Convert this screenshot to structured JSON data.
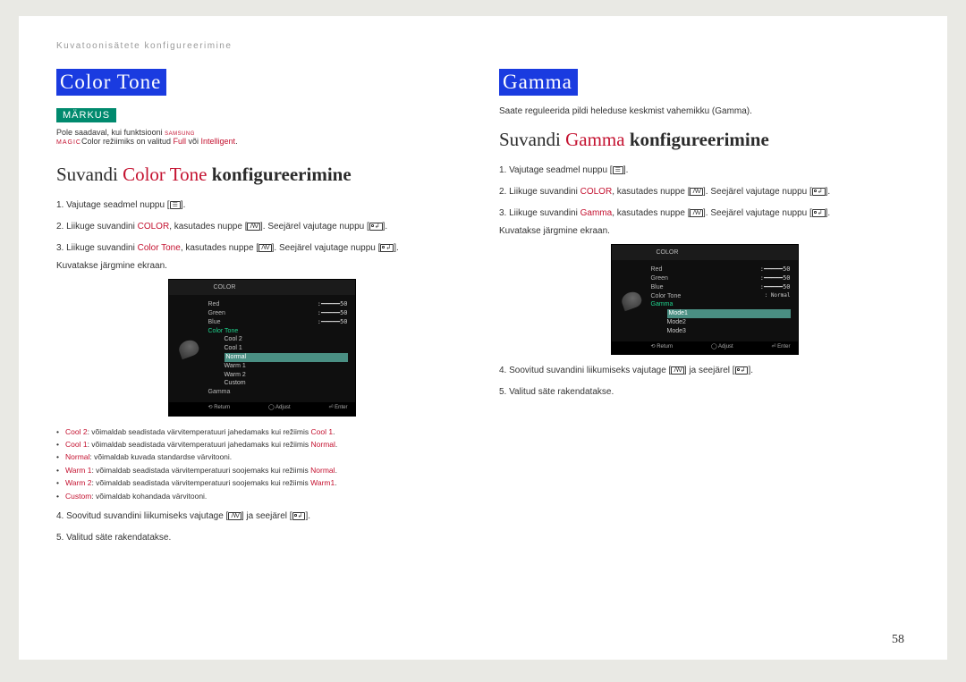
{
  "breadcrumb": "Kuvatoonisätete konfigureerimine",
  "left": {
    "title": "Color Tone",
    "note_label": "MÄRKUS",
    "note_before": "Pole saadaval, kui funktsiooni ",
    "samsung_top": "SAMSUNG",
    "samsung_bot": "MAGIC",
    "note_mid": "Color režiimiks on valitud ",
    "note_full": "Full",
    "note_or": " või ",
    "note_intel": "Intelligent",
    "note_end": ".",
    "subtitle_pre": "Suvandi ",
    "subtitle_accent": "Color Tone",
    "subtitle_post": " konfigureerimine",
    "step1": "Vajutage seadmel nuppu [",
    "step1_end": "].",
    "step2a": "Liikuge suvandini ",
    "step2_color": "COLOR",
    "step2b": ", kasutades nuppe [",
    "step2c": "]. Seejärel vajutage nuppu [",
    "step2d": "].",
    "step3a": "Liikuge suvandini ",
    "step3_ct": "Color Tone",
    "step3b": ", kasutades nuppe [",
    "step3c": "]. Seejärel vajutage nuppu [",
    "step3d": "].",
    "step3_sub": "Kuvatakse järgmine ekraan.",
    "bullets": {
      "b1_k": "Cool 2",
      "b1_t": ": võimaldab seadistada värvitemperatuuri jahedamaks kui režiimis ",
      "b1_r": "Cool 1",
      "b1_e": ".",
      "b2_k": "Cool 1",
      "b2_t": ": võimaldab seadistada värvitemperatuuri jahedamaks kui režiimis ",
      "b2_r": "Normal",
      "b2_e": ".",
      "b3_k": "Normal",
      "b3_t": ": võimaldab kuvada standardse värvitooni.",
      "b4_k": "Warm 1",
      "b4_t": ": võimaldab seadistada värvitemperatuuri soojemaks kui režiimis ",
      "b4_r": "Normal",
      "b4_e": ".",
      "b5_k": "Warm 2",
      "b5_t": ": võimaldab seadistada värvitemperatuuri soojemaks kui režiimis ",
      "b5_r": "Warm1",
      "b5_e": ".",
      "b6_k": "Custom",
      "b6_t": ": võimaldab kohandada värvitooni."
    },
    "step4a": "Soovitud suvandini liikumiseks vajutage [",
    "step4b": "] ja seejärel [",
    "step4c": "].",
    "step5": "Valitud säte rakendatakse.",
    "osd": {
      "hdr": "COLOR",
      "rows": [
        {
          "lab": "Red",
          "val": "50"
        },
        {
          "lab": "Green",
          "val": "50"
        },
        {
          "lab": "Blue",
          "val": "50"
        }
      ],
      "ct_label": "Color Tone",
      "ct_opts": [
        "Cool 2",
        "Cool 1",
        "Normal",
        "Warm 1",
        "Warm 2",
        "Custom"
      ],
      "gamma_label": "Gamma",
      "ftr_return": "Return",
      "ftr_adjust": "Adjust",
      "ftr_enter": "Enter"
    }
  },
  "right": {
    "title": "Gamma",
    "intro": "Saate reguleerida pildi heleduse keskmist vahemikku (Gamma).",
    "subtitle_pre": "Suvandi ",
    "subtitle_accent": "Gamma",
    "subtitle_post": " konfigureerimine",
    "step1": "Vajutage seadmel nuppu [",
    "step1_end": "].",
    "step2a": "Liikuge suvandini ",
    "step2_color": "COLOR",
    "step2b": ", kasutades nuppe [",
    "step2c": "]. Seejärel vajutage nuppu [",
    "step2d": "].",
    "step3a": "Liikuge suvandini ",
    "step3_g": "Gamma",
    "step3b": ", kasutades nuppe [",
    "step3c": "]. Seejärel vajutage nuppu [",
    "step3d": "].",
    "step3_sub": "Kuvatakse järgmine ekraan.",
    "osd": {
      "hdr": "COLOR",
      "rows": [
        {
          "lab": "Red",
          "val": "50"
        },
        {
          "lab": "Green",
          "val": "50"
        },
        {
          "lab": "Blue",
          "val": "50"
        },
        {
          "lab": "Color Tone",
          "val": "Normal"
        }
      ],
      "gamma_label": "Gamma",
      "gamma_opts": [
        "Mode1",
        "Mode2",
        "Mode3"
      ],
      "ftr_return": "Return",
      "ftr_adjust": "Adjust",
      "ftr_enter": "Enter"
    },
    "step4a": "Soovitud suvandini liikumiseks vajutage [",
    "step4b": "] ja seejärel [",
    "step4c": "].",
    "step5": "Valitud säte rakendatakse."
  },
  "page_num": "58"
}
